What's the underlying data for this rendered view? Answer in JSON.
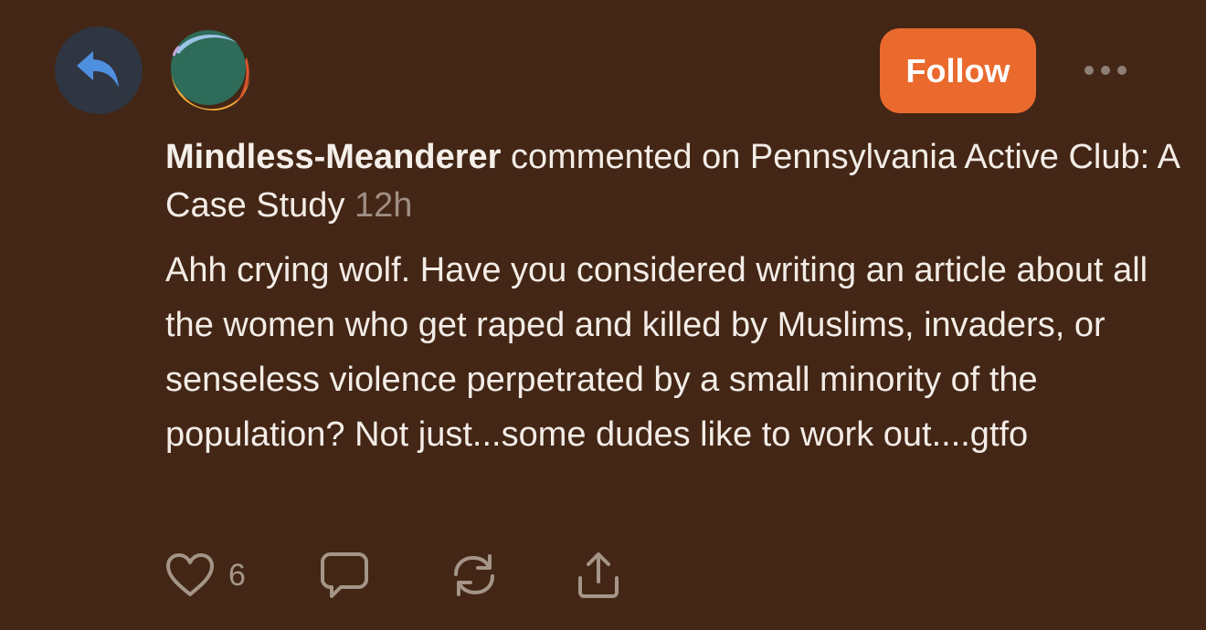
{
  "header": {
    "reply_icon": "reply-arrow-icon",
    "avatar_icon": "user-avatar",
    "follow_label": "Follow",
    "more_icon": "ellipsis-icon"
  },
  "comment": {
    "author": "Mindless-Meanderer",
    "action_text": " commented on Pennsylvania Active Club: A Case Study ",
    "timestamp": "12h",
    "body": "Ahh crying wolf. Have you considered writing an article about all the women who get raped and killed by Muslims, invaders, or senseless violence perpetrated by a small minority of the population? Not just...some dudes like to work out....gtfo"
  },
  "actions": {
    "like_icon": "heart-icon",
    "like_count": "6",
    "reply_icon": "comment-bubble-icon",
    "restack_icon": "restack-icon",
    "share_icon": "share-icon"
  },
  "colors": {
    "background": "#432615",
    "accent": "#ea6a2e",
    "reply_badge": "#2f3541",
    "reply_arrow": "#4f8fe0",
    "muted": "#9f8e83"
  }
}
